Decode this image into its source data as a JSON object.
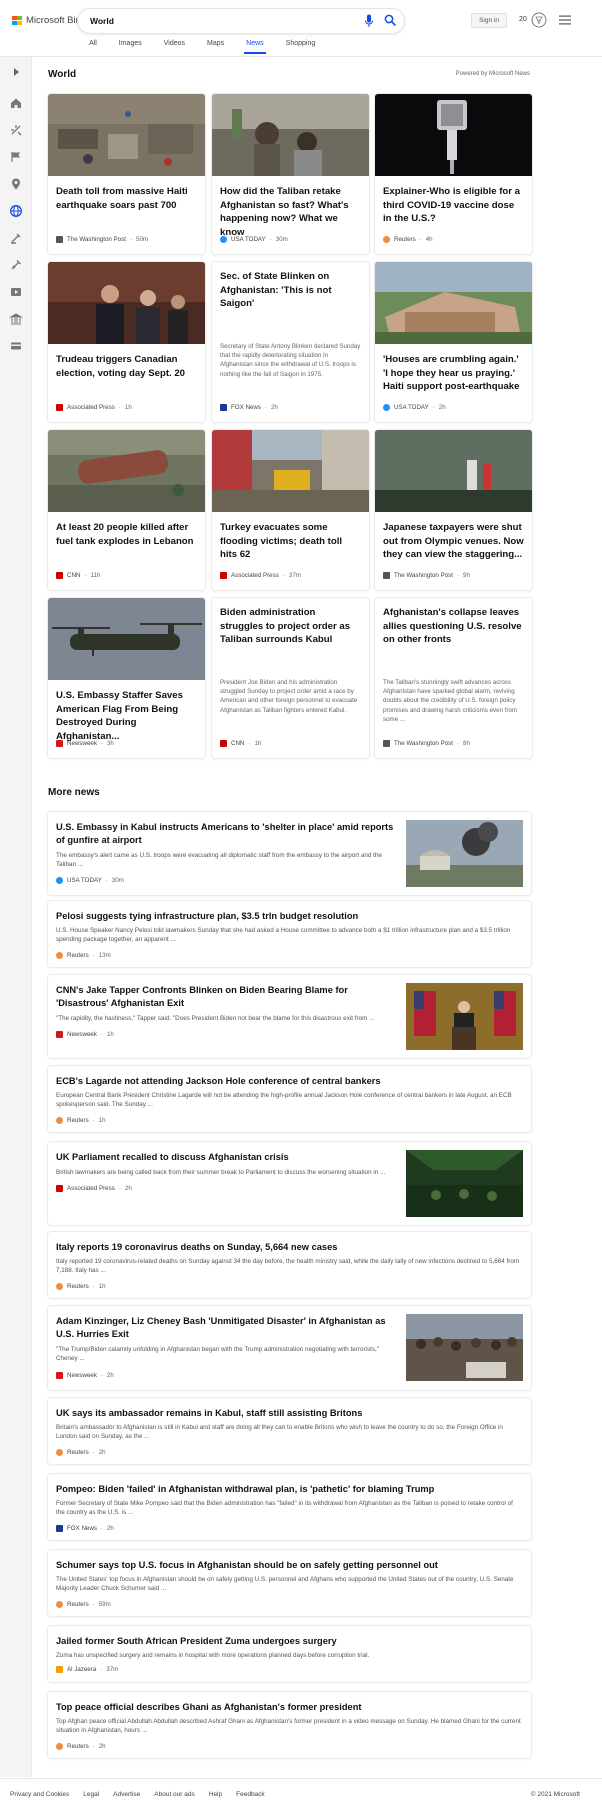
{
  "header": {
    "brand": "Microsoft Bing",
    "search_value": "World",
    "signin_label": "Sign in",
    "rewards_count": "20",
    "tabs": [
      "All",
      "Images",
      "Videos",
      "Maps",
      "News",
      "Shopping"
    ],
    "active_tab": "News"
  },
  "rail": {
    "icons": [
      "expand-icon",
      "home-icon",
      "recommended-icon",
      "us-flag-icon",
      "local-icon",
      "world-icon",
      "politics-icon",
      "science-icon",
      "video-icon",
      "money-icon",
      "finance-icon"
    ]
  },
  "world": {
    "title": "World",
    "powered_by": "Powered by Microsoft News",
    "cards": [
      {
        "title": "Death toll from massive Haiti earthquake soars past 700",
        "source": "The Washington Post",
        "time": "50m"
      },
      {
        "title": "How did the Taliban retake Afghanistan so fast? What's happening now? What we know",
        "source": "USA TODAY",
        "time": "30m"
      },
      {
        "title": "Explainer-Who is eligible for a third COVID-19 vaccine dose in the U.S.?",
        "source": "Reuters",
        "time": "4h"
      },
      {
        "title": "Trudeau triggers Canadian election, voting day Sept. 20",
        "source": "Associated Press",
        "time": "1h"
      },
      {
        "title": "Sec. of State Blinken on Afghanistan: 'This is not Saigon'",
        "snippet": "Secretary of State Antony Blinken declared Sunday that the rapidly deteriorating situation in Afghanistan since the withdrawal of U.S. troops is nothing like the fall of Saigon in 1975.",
        "source": "FOX News",
        "time": "2h"
      },
      {
        "title": "'Houses are crumbling again.' 'I hope they hear us praying.' Haiti support post-earthquake",
        "source": "USA TODAY",
        "time": "2h"
      },
      {
        "title": "At least 20 people killed after fuel tank explodes in Lebanon",
        "source": "CNN",
        "time": "11h"
      },
      {
        "title": "Turkey evacuates some flooding victims; death toll hits 62",
        "source": "Associated Press",
        "time": "37m"
      },
      {
        "title": "Japanese taxpayers were shut out from Olympic venues. Now they can view the staggering...",
        "source": "The Washington Post",
        "time": "9h"
      },
      {
        "title": "U.S. Embassy Staffer Saves American Flag From Being Destroyed During Afghanistan...",
        "source": "Newsweek",
        "time": "3h"
      },
      {
        "title": "Biden administration struggles to project order as Taliban surrounds Kabul",
        "snippet": "President Joe Biden and his administration struggled Sunday to project order amid a race by American and other foreign personnel to evacuate Afghanistan as Taliban fighters entered Kabul.",
        "source": "CNN",
        "time": "1h"
      },
      {
        "title": "Afghanistan's collapse leaves allies questioning U.S. resolve on other fronts",
        "snippet": "The Taliban's stunningly swift advances across Afghanistan have sparked global alarm, reviving doubts about the credibility of U.S. foreign policy promises and drawing harsh criticisms even from some ...",
        "source": "The Washington Post",
        "time": "8h"
      }
    ]
  },
  "more_news": {
    "title": "More news",
    "items": [
      {
        "title": "U.S. Embassy in Kabul instructs Americans to 'shelter in place' amid reports of gunfire at airport",
        "snippet": "The embassy's alert came as U.S. troops were evacuating all diplomatic staff from the embassy to the airport and the Taliban ...",
        "source": "USA TODAY",
        "time": "30m"
      },
      {
        "title": "Pelosi suggests tying infrastructure plan, $3.5 trln budget resolution",
        "snippet": "U.S. House Speaker Nancy Pelosi told lawmakers Sunday that she had asked a House committee to advance both a $1 trillion infrastructure plan and a $3.5 trillion spending package together, an apparent ...",
        "source": "Reuters",
        "time": "13m"
      },
      {
        "title": "CNN's Jake Tapper Confronts Blinken on Biden Bearing Blame for 'Disastrous' Afghanistan Exit",
        "snippet": "\"The rapidity, the hastiness,\" Tapper said. \"Does President Biden not bear the blame for this disastrous exit from ...",
        "source": "Newsweek",
        "time": "1h"
      },
      {
        "title": "ECB's Lagarde not attending Jackson Hole conference of central bankers",
        "snippet": "European Central Bank President Christine Lagarde will not be attending the high-profile annual Jackson Hole conference of central bankers in late August, an ECB spokesperson said. The Sunday ...",
        "source": "Reuters",
        "time": "1h"
      },
      {
        "title": "UK Parliament recalled to discuss Afghanistan crisis",
        "snippet": "British lawmakers are being called back from their summer break to Parliament to discuss the worsening situation in ...",
        "source": "Associated Press",
        "time": "2h"
      },
      {
        "title": "Italy reports 19 coronavirus deaths on Sunday, 5,664 new cases",
        "snippet": "Italy reported 19 coronavirus-related deaths on Sunday against 34 the day before, the health ministry said, while the daily tally of new infections declined to 5,664 from 7,188. Italy has ...",
        "source": "Reuters",
        "time": "1h"
      },
      {
        "title": "Adam Kinzinger, Liz Cheney Bash 'Unmitigated Disaster' in Afghanistan as U.S. Hurries Exit",
        "snippet": "\"The Trump/Biden calamity unfolding in Afghanistan began with the Trump administration negotiating with terrorists,\" Cheney ...",
        "source": "Newsweek",
        "time": "2h"
      },
      {
        "title": "UK says its ambassador remains in Kabul, staff still assisting Britons",
        "snippet": "Britain's ambassador to Afghanistan is still in Kabul and staff are doing all they can to enable Britons who wish to leave the country to do so, the Foreign Office in London said on Sunday, as the ...",
        "source": "Reuters",
        "time": "2h"
      },
      {
        "title": "Pompeo: Biden 'failed' in Afghanistan withdrawal plan, is 'pathetic' for blaming Trump",
        "snippet": "Former Secretary of State Mike Pompeo said that the Biden administration has \"failed\" in its withdrawal from Afghanistan as the Taliban is poised to retake control of the country as the U.S. is ...",
        "source": "FOX News",
        "time": "2h"
      },
      {
        "title": "Schumer says top U.S. focus in Afghanistan should be on safely getting personnel out",
        "snippet": "The United States' top focus in Afghanistan should be on safely getting U.S. personnel and Afghans who supported the United States out of the country, U.S. Senate Majority Leader Chuck Schumer said ...",
        "source": "Reuters",
        "time": "59m"
      },
      {
        "title": "Jailed former South African President Zuma undergoes surgery",
        "snippet": "Zuma has unspecified surgery and remains in hospital with more operations planned days before corruption trial.",
        "source": "Al Jazeera",
        "time": "37m"
      },
      {
        "title": "Top peace official describes Ghani as Afghanistan's former president",
        "snippet": "Top Afghan peace official Abdullah Abdullah described Ashraf Ghani as Afghanistan's former president in a video message on Sunday. He blamed Ghani for the current situation in Afghanistan, hours ...",
        "source": "Reuters",
        "time": "2h"
      }
    ]
  },
  "footer": {
    "links": [
      "Privacy and Cookies",
      "Legal",
      "Advertise",
      "About our ads",
      "Help",
      "Feedback"
    ],
    "copyright": "© 2021 Microsoft"
  },
  "colors": {
    "accent": "#174ae4",
    "washington_post": "#555555",
    "usa_today": "#1e90ff",
    "reuters": "#f08c3c",
    "associated_press": "#d40000",
    "fox_news": "#1a3a8c",
    "cnn": "#cc0000",
    "newsweek": "#d21a1a",
    "al_jazeera": "#f2a100"
  }
}
